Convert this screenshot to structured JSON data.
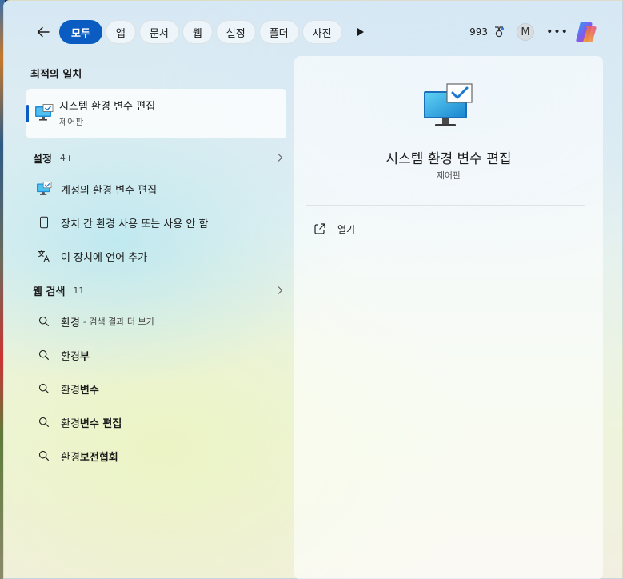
{
  "topbar": {
    "filters": [
      "모두",
      "앱",
      "문서",
      "웹",
      "설정",
      "폴더",
      "사진"
    ],
    "points": "993",
    "avatar_letter": "M"
  },
  "best_match": {
    "heading": "최적의 일치",
    "title": "시스템 환경 변수 편집",
    "subtitle": "제어판"
  },
  "settings_group": {
    "label": "설정",
    "count": "4+",
    "items": [
      {
        "label": "계정의 환경 변수 편집",
        "icon": "monitor-check-icon"
      },
      {
        "label": "장치 간 환경 사용 또는 사용 안 함",
        "icon": "phone-icon"
      },
      {
        "label": "이 장치에 언어 추가",
        "icon": "language-icon"
      }
    ]
  },
  "web_group": {
    "label": "웹 검색",
    "count": "11",
    "items": [
      {
        "prefix": "환경",
        "bold": "",
        "suffix": "- 검색 결과 더 보기"
      },
      {
        "prefix": "환경",
        "bold": "부",
        "suffix": ""
      },
      {
        "prefix": "환경",
        "bold": "변수",
        "suffix": ""
      },
      {
        "prefix": "환경",
        "bold": "변수 편집",
        "suffix": ""
      },
      {
        "prefix": "환경",
        "bold": "보전협회",
        "suffix": ""
      }
    ]
  },
  "detail": {
    "title": "시스템 환경 변수 편집",
    "subtitle": "제어판",
    "open_label": "열기"
  },
  "colors": {
    "accent": "#0a5cc2"
  }
}
